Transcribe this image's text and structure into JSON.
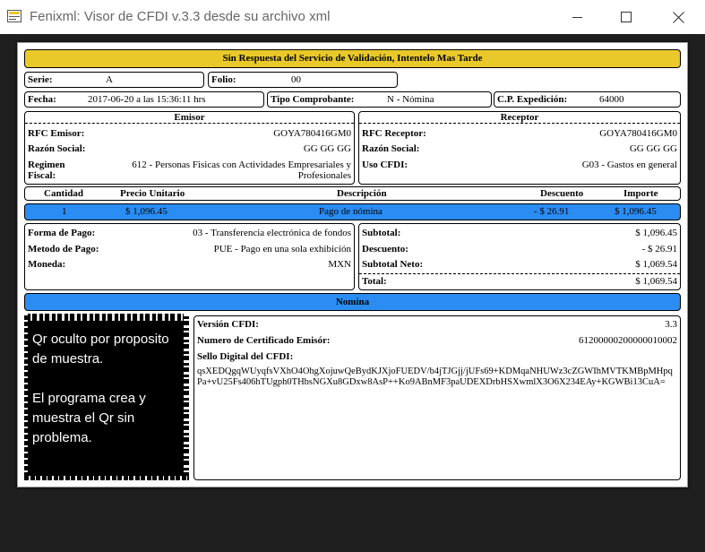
{
  "window": {
    "title": "Fenixml: Visor de CFDI v.3.3 desde su archivo xml",
    "icon": "app-icon",
    "minimize_glyph": "—",
    "maximize_glyph": "☐",
    "close_glyph": "✕"
  },
  "banner": {
    "text": "Sin Respuesta del Servicio de Validación, Intentelo Mas Tarde",
    "color": "#e9c92a"
  },
  "serie": {
    "label": "Serie:",
    "value": "A"
  },
  "folio": {
    "label": "Folio:",
    "value": "00"
  },
  "fecha": {
    "label": "Fecha:",
    "value": "2017-06-20 a las 15:36:11 hrs"
  },
  "tipo_comprobante": {
    "label": "Tipo Comprobante:",
    "value": "N - Nómina"
  },
  "cp_expedicion": {
    "label": "C.P. Expedición:",
    "value": "64000"
  },
  "emisor": {
    "heading": "Emisor",
    "rfc_label": "RFC Emisor:",
    "rfc": "GOYA780416GM0",
    "razon_label": "Razón Social:",
    "razon": "GG GG GG",
    "regimen_label": "Regimen\nFiscal:",
    "regimen": "612 - Personas Fisicas con Actividades Empresariales y\nProfesionales"
  },
  "receptor": {
    "heading": "Receptor",
    "rfc_label": "RFC Receptor:",
    "rfc": "GOYA780416GM0",
    "razon_label": "Razón Social:",
    "razon": "GG GG GG",
    "uso_label": "Uso CFDI:",
    "uso": "G03 - Gastos en general"
  },
  "conceptos": {
    "headers": [
      "Cantidad",
      "Precio Unitario",
      "Descripción",
      "Descuento",
      "Importe"
    ],
    "rows": [
      {
        "cantidad": "1",
        "precio": "$ 1,096.45",
        "descripcion": "Pago de nómina",
        "descuento": "- $ 26.91",
        "importe": "$ 1,096.45"
      }
    ],
    "row_color": "#2b8cf1"
  },
  "pago": {
    "forma_label": "Forma de Pago:",
    "forma": "03 - Transferencia electrónica de fondos",
    "metodo_label": "Metodo de Pago:",
    "metodo": "PUE - Pago en una sola exhibición",
    "moneda_label": "Moneda:",
    "moneda": "MXN"
  },
  "totales": {
    "subtotal_label": "Subtotal:",
    "subtotal": "$ 1,096.45",
    "descuento_label": "Descuento:",
    "descuento": "- $ 26.91",
    "neto_label": "Subtotal Neto:",
    "neto": "$ 1,069.54",
    "total_label": "Total:",
    "total": "$ 1,069.54"
  },
  "nomina": {
    "text": "Nomina",
    "color": "#2b8cf1"
  },
  "qr": {
    "text": "Qr oculto por proposito de muestra.\n\nEl programa crea y muestra el Qr sin problema."
  },
  "timbre": {
    "version_label": "Versión CFDI:",
    "version": "3.3",
    "certificado_label": "Numero de Certificado Emisór:",
    "certificado": "61200000200000010002",
    "sello_label": "Sello Digital del CFDI:",
    "sello": "qsXEDQgqWUyqfsVXhO4OhgXojuwQeBydKJXjoFUEDV/b4jTJGjj/jUFs69+KDMqaNHUWz3cZGWIhMVTKMBpMHpqPa+vU25Fs406hTUgph0THbsNGXu8GDxw8AsP++Ko9ABnMF3paUDEXDrbHSXwmlX3O6X234EAy+KGWBi13CuA="
  }
}
